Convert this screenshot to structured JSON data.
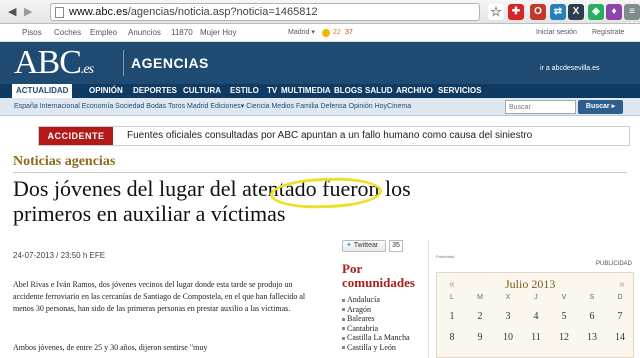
{
  "browser": {
    "url_domain": "www.abc.es",
    "url_path": "/agencias/noticia.asp?noticia=1465812",
    "extensions": [
      {
        "name": "star-icon",
        "glyph": "☆",
        "color": "#ffffff"
      },
      {
        "name": "plus-icon",
        "glyph": "✚",
        "color": "#d92525"
      },
      {
        "name": "mail-icon",
        "glyph": "O",
        "color": "#c0392b"
      },
      {
        "name": "sync-icon",
        "glyph": "⇄",
        "color": "#2980b9"
      },
      {
        "name": "x-icon",
        "glyph": "X",
        "color": "#2c3e50"
      },
      {
        "name": "lock-icon",
        "glyph": "◈",
        "color": "#27ae60"
      },
      {
        "name": "shield-icon",
        "glyph": "♦",
        "color": "#8e44ad"
      },
      {
        "name": "menu-icon",
        "glyph": "≡",
        "color": "#7f8c8d"
      }
    ]
  },
  "toplinks": {
    "items": [
      "Pisos",
      "Coches",
      "Empleo",
      "Anuncios",
      "11870",
      "Mujer Hoy"
    ],
    "weather_city": "Madrid ▾",
    "temp_max": "22",
    "temp_min": "37",
    "login": "Iniciar sesión",
    "register": "Regístrate"
  },
  "header": {
    "logo_main": "ABC",
    "logo_tld": ".es",
    "section": "AGENCIAS",
    "sevilla_link": "ir a abcdesevilla.es"
  },
  "nav": {
    "items": [
      "ACTUALIDAD",
      "OPINIÓN",
      "DEPORTES",
      "CULTURA",
      "ESTILO",
      "TV",
      "MULTIMEDIA",
      "BLOGS",
      "SALUD",
      "ARCHIVO",
      "SERVICIOS"
    ]
  },
  "subnav": {
    "text": "España Internacional Economía Sociedad Bodas Toros Madrid Ediciones▾ Ciencia Medios Familia Defensa Opinión HoyCinema",
    "search_placeholder": "Buscar",
    "search_button": "Buscar ▸"
  },
  "ticker": {
    "label": "ACCIDENTE",
    "text": "Fuentes oficiales consultadas por ABC apuntan a un fallo humano como causa del siniestro"
  },
  "article": {
    "kicker": "Noticias agencias",
    "headline_line1": "Dos jóvenes del lugar del atentado fueron los",
    "headline_line2": "primeros en auxiliar a víctimas",
    "dateline": "24-07-2013 / 23:50 h EFE",
    "body1": "Abel Rivas e Iván Ramos, dos jóvenes vecinos del lugar donde esta tarde se produjo un accidente ferroviario en las cercanías de Santiago de Compostela, en el que han fallecido al menos 30 personas, han sido de las primeras personas en prestar auxilio a las víctimas.",
    "body2": "Ambos jóvenes, de entre 25 y 30 años, dijeron sentirse \"muy"
  },
  "share": {
    "twitter_label": "Twittear",
    "twitter_count": "35"
  },
  "comunidades": {
    "title_line1": "Por",
    "title_line2": "comunidades",
    "items": [
      "Andalucía",
      "Aragón",
      "Baleares",
      "Cantabria",
      "Castilla La Mancha",
      "Castilla y León"
    ]
  },
  "sidebar": {
    "publicidad_small": "Publicidad",
    "publicidad": "PUBLICIDAD"
  },
  "calendar": {
    "prev": "«",
    "next": "»",
    "title": "Julio 2013",
    "weekdays": [
      "L",
      "M",
      "X",
      "J",
      "V",
      "S",
      "D"
    ],
    "weeks": [
      [
        "1",
        "2",
        "3",
        "4",
        "5",
        "6",
        "7"
      ],
      [
        "8",
        "9",
        "10",
        "11",
        "12",
        "13",
        "14"
      ]
    ]
  }
}
